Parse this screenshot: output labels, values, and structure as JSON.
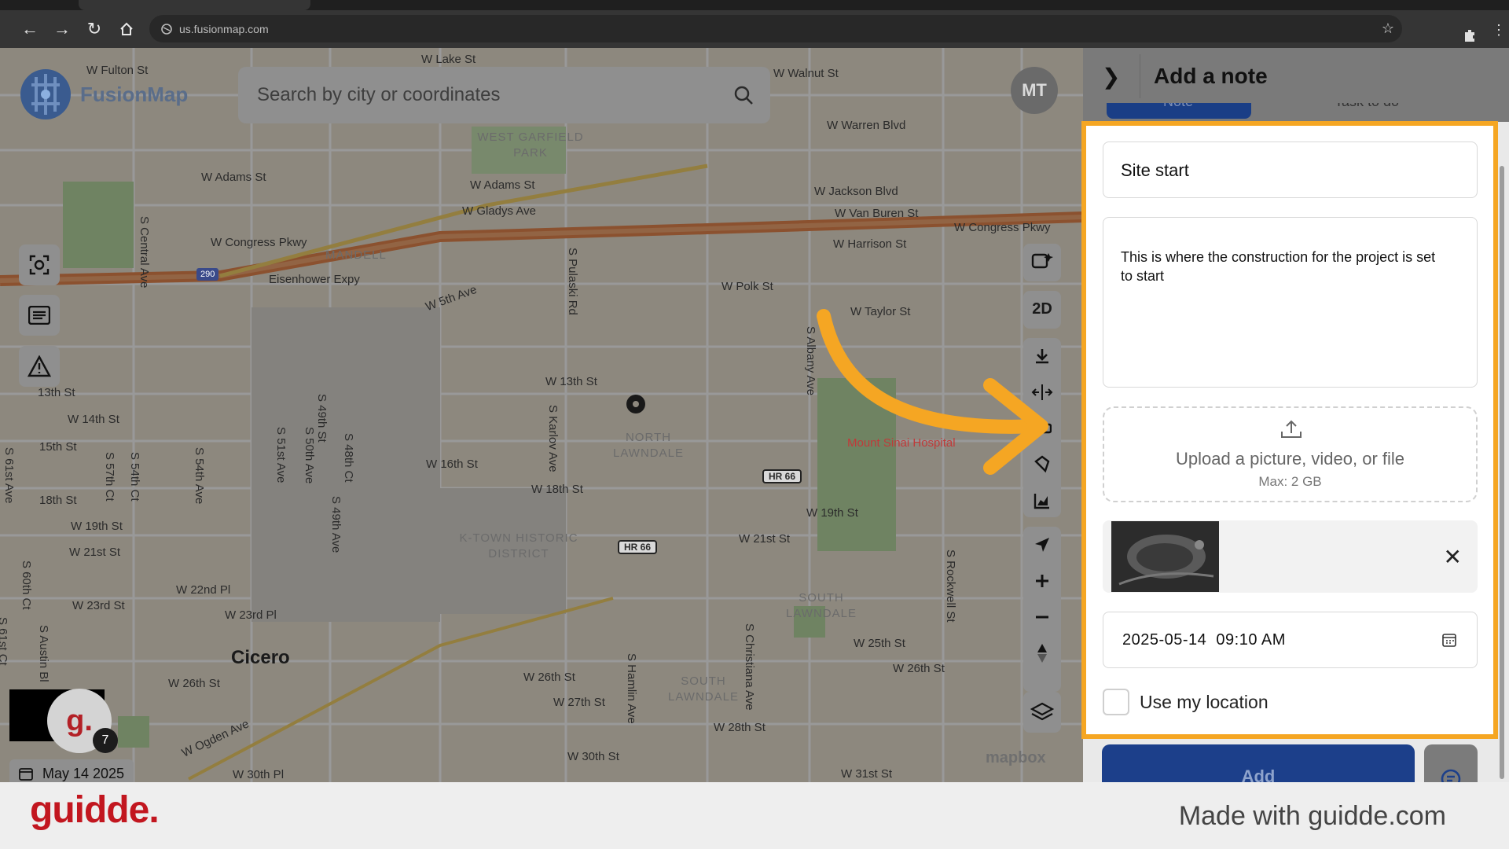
{
  "browser": {
    "url": "us.fusionmap.com"
  },
  "app": {
    "logo_text": "FusionMap",
    "search_placeholder": "Search by city or coordinates",
    "avatar_initials": "MT"
  },
  "map": {
    "streets": [
      "W Fulton St",
      "W Lake St",
      "W Walnut St",
      "W Warren Blvd",
      "W Adams St",
      "W Adams St",
      "W Gladys Ave",
      "W Jackson Blvd",
      "W Van Buren St",
      "W Congress Pkwy",
      "W Congress Pkwy",
      "W Harrison St",
      "Eisenhower Expy",
      "W 5th Ave",
      "W Polk St",
      "W Taylor St",
      "13th St",
      "W 14th St",
      "15th St",
      "W 13th St",
      "18th St",
      "W 16th St",
      "W 18th St",
      "W 19th St",
      "W 21st St",
      "W 19th St",
      "W 21st St",
      "W 22nd Pl",
      "W 23rd St",
      "W 23rd Pl",
      "W 26th St",
      "W 26th St",
      "W 27th St",
      "W 25th St",
      "W 26th St",
      "W 28th St",
      "W 30th St",
      "W 30th Pl",
      "W Ogden Ave",
      "W 31st St"
    ],
    "vertical_streets": [
      "S Central Ave",
      "S Pulaski Rd",
      "S Albany Ave",
      "S Karlov Ave",
      "S 49th St",
      "S 51st Ave",
      "S 50th Ave",
      "S 48th Ct",
      "S 49th Ave",
      "S 54th Ave",
      "S 57th Ct",
      "S 54th Ct",
      "S 61st Ave",
      "S 60th Ct",
      "S Austin Bl",
      "S 61st Ct",
      "S Hamlin Ave",
      "S Christiana Ave",
      "S Rockwell St"
    ],
    "neighborhoods": [
      "WEST GARFIELD PARK",
      "MANDELL",
      "NORTH LAWNDALE",
      "K-TOWN HISTORIC DISTRICT",
      "SOUTH LAWNDALE",
      "SOUTH LAWNDALE"
    ],
    "city": "Cicero",
    "hospital": "Mount Sinai Hospital",
    "highway_shield": "290",
    "route_badges": [
      "HR 66",
      "HR 66"
    ],
    "attribution": "mapbox",
    "view_mode": "2D"
  },
  "bottom_left": {
    "guidde_letter": "g.",
    "badge_count": "7",
    "date_chip": "May 14 2025"
  },
  "panel": {
    "title": "Add a note",
    "tabs": [
      "Note",
      "Task to do"
    ],
    "note_title": "Site start",
    "note_description": "This is where the construction for the project is set to start",
    "upload_label": "Upload a picture, video, or file",
    "upload_max": "Max: 2 GB",
    "datetime": "2025-05-14  09:10 AM",
    "use_location_label": "Use my location",
    "use_location_checked": false,
    "add_button": "Add"
  },
  "colors": {
    "highlight": "#f5a623",
    "brand_red": "#c2161f",
    "primary_blue": "#1c3f8a"
  },
  "footer": {
    "brand": "guidde.",
    "made_with": "Made with guidde.com"
  }
}
